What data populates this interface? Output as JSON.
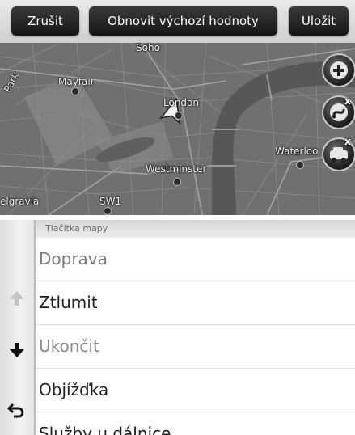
{
  "toolbar": {
    "cancel_label": "Zrušit",
    "reset_label": "Obnovit výchozí hodnoty",
    "save_label": "Uložit"
  },
  "map": {
    "labels": {
      "soho": "Soho",
      "mayfair": "Mayfair",
      "london": "London",
      "westminster": "Westminster",
      "waterloo": "Waterloo",
      "park": "Park",
      "belgravia": "elgravia",
      "sw1": "SW1"
    },
    "controls": {
      "zoom_in_icon": "plus-icon",
      "route_icon": "route-remove-icon",
      "traffic_icon": "traffic-remove-icon",
      "remove_mark": "x"
    }
  },
  "list": {
    "header": "Tlačítka mapy",
    "items": [
      {
        "label": "Doprava",
        "color": "#7a7a7a"
      },
      {
        "label": "Ztlumit",
        "color": "#1e1e1e"
      },
      {
        "label": "Ukončit",
        "color": "#8a8a8a"
      },
      {
        "label": "Objížďka",
        "color": "#1e1e1e"
      },
      {
        "label": "Služby u dálnice",
        "color": "#1e1e1e"
      }
    ],
    "side_icons": [
      "arrow-up-icon",
      "arrow-down-icon",
      "back-icon"
    ]
  },
  "colors": {
    "button_bg": "#1f1f1f",
    "map_bg": "#6e6e6e",
    "river": "#5a5a5a"
  }
}
